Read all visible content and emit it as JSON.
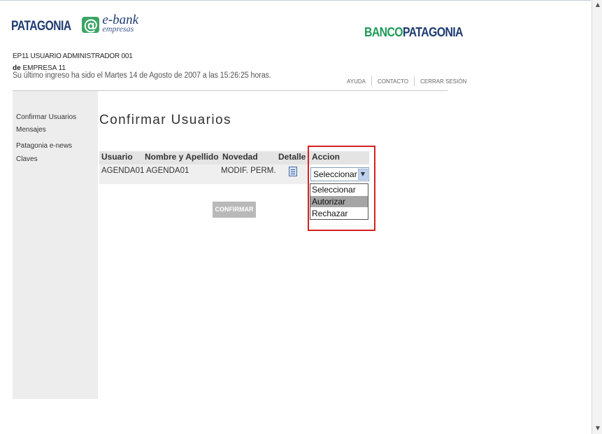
{
  "header": {
    "logo_text": "PATAGONIA",
    "logo_at": "@",
    "logo_ebank": "e-bank",
    "logo_empresas": "empresas",
    "bank_logo_a": "BANCO",
    "bank_logo_b": "PATAGONIA",
    "user_line": "EP11 USUARIO ADMINISTRADOR 001",
    "company_prefix": "de",
    "company_name": "EMPRESA 11",
    "last_login": "Su último ingreso ha sido el Martes 14 de Agosto de 2007 a las 15:26:25 horas.",
    "links": {
      "help": "AYUDA",
      "contact": "CONTACTO",
      "logout": "CERRAR SESIÓN"
    }
  },
  "sidebar": {
    "items": [
      {
        "label": "Confirmar Usuarios"
      },
      {
        "label": "Mensajes"
      },
      {
        "label": "Patagonia e-news"
      },
      {
        "label": "Claves"
      }
    ]
  },
  "main": {
    "title": "Confirmar Usuarios",
    "table": {
      "columns": [
        "Usuario",
        "Nombre y Apellido",
        "Novedad",
        "Detalle",
        "Accion"
      ],
      "rows": [
        {
          "usuario": "AGENDA01",
          "nombre": "AGENDA01",
          "novedad": "MODIF. PERM.",
          "detalle_icon": "document-icon",
          "accion": "Seleccionar"
        }
      ]
    },
    "dropdown": {
      "selected": "Seleccionar",
      "options": [
        "Seleccionar",
        "Autorizar",
        "Rechazar"
      ],
      "highlighted_index": 1
    },
    "confirm_label": "CONFIRMAR"
  },
  "colors": {
    "navy": "#1e3b72",
    "green": "#1f9a57",
    "highlight_border": "#d62021",
    "sidebar_bg": "#ededed",
    "button_disabled": "#b9b9b9"
  }
}
